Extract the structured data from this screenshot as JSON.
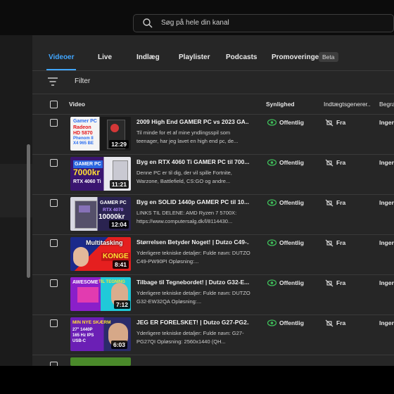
{
  "search": {
    "placeholder": "Søg på hele din kanal"
  },
  "tabs": [
    {
      "label": "Videoer"
    },
    {
      "label": "Live"
    },
    {
      "label": "Indlæg"
    },
    {
      "label": "Playlister"
    },
    {
      "label": "Podcasts"
    },
    {
      "label": "Promoveringer"
    }
  ],
  "beta_badge": "Beta",
  "filter": {
    "label": "Filter"
  },
  "columns": {
    "video": "Video",
    "visibility": "Synlighed",
    "generated": "Indtægtsgenerer...",
    "restrictions": "Begræ"
  },
  "rows": [
    {
      "title": "2009 High End GAMER PC vs 2023 GA...",
      "description": "Til minde for et af mine yndlingsspil som teenager, har jeg lavet en high end pc, de...",
      "visibility": "Offentlig",
      "monetization": "Fra",
      "restriction": "Ingen",
      "duration": "12:29",
      "thumb_text": [
        "Gamer PC",
        "Radeon",
        "HD 5870",
        "Phenom II",
        "X4 965 BE"
      ]
    },
    {
      "title": "Byg en RTX 4060 Ti GAMER PC til 700...",
      "description": "Denne PC er til dig, der vil spille Fortnite, Warzone, Battlefield, CS:GO og andre...",
      "visibility": "Offentlig",
      "monetization": "Fra",
      "restriction": "Ingen",
      "duration": "11:21",
      "thumb_text": [
        "GAMER PC",
        "7000kr",
        "RTX 4060 Ti"
      ]
    },
    {
      "title": "Byg en SOLID 1440p GAMER PC til 10...",
      "description": "LINKS TIL DELENE: AMD Ryzen 7 5700X: https://www.computersalg.dk/l/8114430...",
      "visibility": "Offentlig",
      "monetization": "Fra",
      "restriction": "Ingen",
      "duration": "12:04",
      "thumb_text": [
        "GAMER PC",
        "RTX 4070",
        "10000kr"
      ]
    },
    {
      "title": "Størrelsen Betyder Noget! | Dutzo C49-...",
      "description": "Yderligere tekniske detaljer: Fulde navn: DUTZO C49-PW90PI Opløsning:...",
      "visibility": "Offentlig",
      "monetization": "Fra",
      "restriction": "Ingen",
      "duration": "8:41",
      "thumb_text": [
        "Multitasking",
        "KONGE"
      ]
    },
    {
      "title": "Tilbage til Tegnebordet! | Dutzo G32-E...",
      "description": "Yderligere tekniske detaljer: Fulde navn: DUTZO G32-EW32QA Opløsning:...",
      "visibility": "Offentlig",
      "monetization": "Fra",
      "restriction": "Ingen",
      "duration": "7:12",
      "thumb_text": [
        "AWESOME",
        "TIL TEGNING"
      ]
    },
    {
      "title": "JEG ER FORELSKET! | Dutzo G27-PG2...",
      "description": "Yderligere tekniske detaljer: Fulde navn: G27-PG27QI Opløsning: 2560x1440 (QH...",
      "visibility": "Offentlig",
      "monetization": "Fra",
      "restriction": "Ingen",
      "duration": "6:03",
      "thumb_text": [
        "MIN NYE SKÆRM",
        "27\" 1440P",
        "165 Hz IPS",
        "USB-C"
      ]
    }
  ],
  "colors": {
    "accent": "#41a6ff",
    "visible_icon": "#3fbf5a",
    "panel": "#262626"
  }
}
